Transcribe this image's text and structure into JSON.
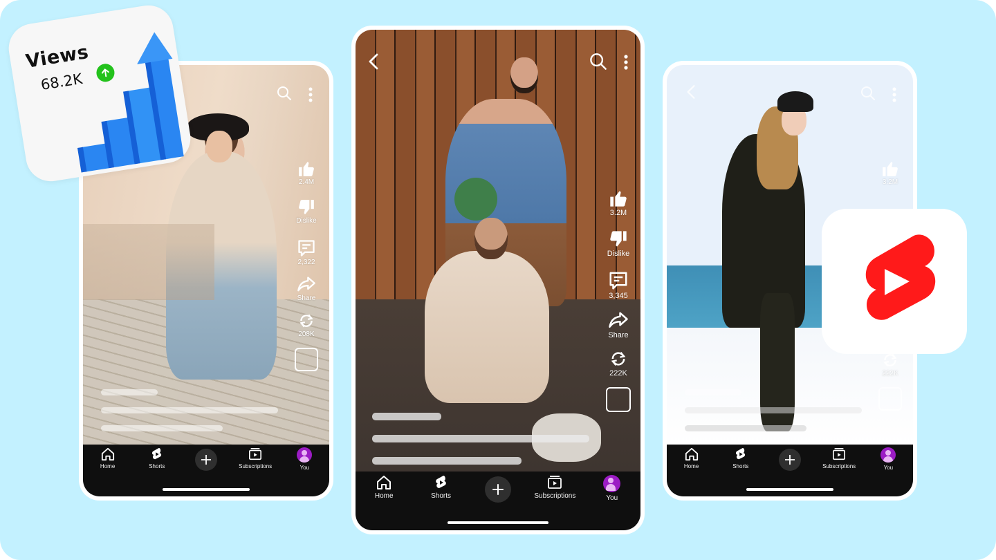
{
  "views_card": {
    "title": "Views",
    "count": "68.2K",
    "trend_icon": "arrow-up-icon",
    "trend_color": "#23c21c",
    "chart_icon": "rising-bar-chart-icon",
    "chart_color": "#1e78f0"
  },
  "shorts_logo": {
    "icon": "youtube-shorts-logo",
    "color": "#ff1a1a"
  },
  "nav": {
    "items": [
      {
        "label": "Home",
        "icon": "home-icon"
      },
      {
        "label": "Shorts",
        "icon": "shorts-icon"
      },
      {
        "label": "",
        "icon": "plus-icon"
      },
      {
        "label": "Subscriptions",
        "icon": "subscriptions-icon"
      },
      {
        "label": "You",
        "icon": "avatar"
      }
    ],
    "avatar_color": "#9b1cc4"
  },
  "phones": {
    "left": {
      "likes": "2.4M",
      "dislike": "Dislike",
      "comments": "2,322",
      "share": "Share",
      "remix": "208K"
    },
    "center": {
      "likes": "3.2M",
      "dislike": "Dislike",
      "comments": "3,345",
      "share": "Share",
      "remix": "222K"
    },
    "right": {
      "likes": "3.2M",
      "remix": "222K"
    }
  },
  "colors": {
    "background": "#c3f1ff",
    "nav_bg": "#0f0f0f",
    "frame": "#ffffff"
  }
}
